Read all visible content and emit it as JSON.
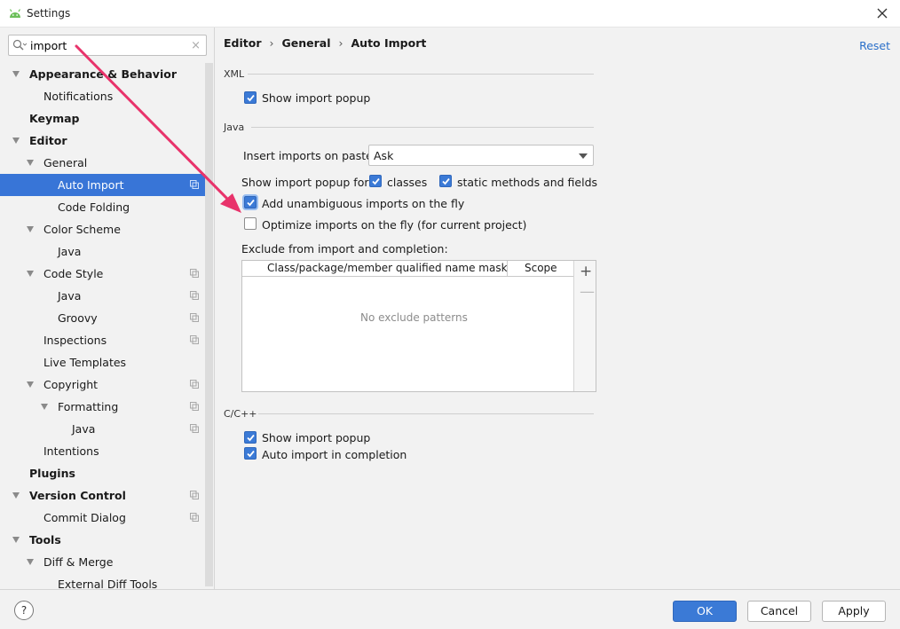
{
  "window": {
    "title": "Settings"
  },
  "search": {
    "value": "import"
  },
  "tree": [
    {
      "label": "Appearance & Behavior",
      "level": 0,
      "bold": true,
      "expanded": true,
      "copy": false
    },
    {
      "label": "Notifications",
      "level": 1,
      "bold": false,
      "expanded": null,
      "copy": false
    },
    {
      "label": "Keymap",
      "level": 0,
      "bold": true,
      "expanded": null,
      "copy": false
    },
    {
      "label": "Editor",
      "level": 0,
      "bold": true,
      "expanded": true,
      "copy": false
    },
    {
      "label": "General",
      "level": 1,
      "bold": false,
      "expanded": true,
      "copy": false
    },
    {
      "label": "Auto Import",
      "level": 2,
      "bold": false,
      "expanded": null,
      "copy": true,
      "selected": true
    },
    {
      "label": "Code Folding",
      "level": 2,
      "bold": false,
      "expanded": null,
      "copy": false
    },
    {
      "label": "Color Scheme",
      "level": 1,
      "bold": false,
      "expanded": true,
      "copy": false
    },
    {
      "label": "Java",
      "level": 2,
      "bold": false,
      "expanded": null,
      "copy": false
    },
    {
      "label": "Code Style",
      "level": 1,
      "bold": false,
      "expanded": true,
      "copy": true
    },
    {
      "label": "Java",
      "level": 2,
      "bold": false,
      "expanded": null,
      "copy": true
    },
    {
      "label": "Groovy",
      "level": 2,
      "bold": false,
      "expanded": null,
      "copy": true
    },
    {
      "label": "Inspections",
      "level": 1,
      "bold": false,
      "expanded": null,
      "copy": true
    },
    {
      "label": "Live Templates",
      "level": 1,
      "bold": false,
      "expanded": null,
      "copy": false
    },
    {
      "label": "Copyright",
      "level": 1,
      "bold": false,
      "expanded": true,
      "copy": true
    },
    {
      "label": "Formatting",
      "level": 2,
      "bold": false,
      "expanded": true,
      "copy": true
    },
    {
      "label": "Java",
      "level": 3,
      "bold": false,
      "expanded": null,
      "copy": true
    },
    {
      "label": "Intentions",
      "level": 1,
      "bold": false,
      "expanded": null,
      "copy": false
    },
    {
      "label": "Plugins",
      "level": 0,
      "bold": true,
      "expanded": null,
      "copy": false
    },
    {
      "label": "Version Control",
      "level": 0,
      "bold": true,
      "expanded": true,
      "copy": true
    },
    {
      "label": "Commit Dialog",
      "level": 1,
      "bold": false,
      "expanded": null,
      "copy": true
    },
    {
      "label": "Tools",
      "level": 0,
      "bold": true,
      "expanded": true,
      "copy": false
    },
    {
      "label": "Diff & Merge",
      "level": 1,
      "bold": false,
      "expanded": true,
      "copy": false
    },
    {
      "label": "External Diff Tools",
      "level": 2,
      "bold": false,
      "expanded": null,
      "copy": false
    }
  ],
  "breadcrumb": {
    "part1": "Editor",
    "sep": "›",
    "part2": "General",
    "part3": "Auto Import"
  },
  "reset_label": "Reset",
  "xml": {
    "title": "XML",
    "show_popup": {
      "label": "Show import popup",
      "checked": true
    }
  },
  "java": {
    "title": "Java",
    "insert_label": "Insert imports on paste:",
    "insert_value": "Ask",
    "popup_for_label": "Show import popup for:",
    "classes": {
      "label": "classes",
      "checked": true
    },
    "static_methods": {
      "label": "static methods and fields",
      "checked": true
    },
    "add_unambiguous": {
      "label": "Add unambiguous imports on the fly",
      "checked": true
    },
    "optimize": {
      "label": "Optimize imports on the fly (for current project)",
      "checked": false
    },
    "exclude_label": "Exclude from import and completion:",
    "table": {
      "col1": "Class/package/member qualified name mask",
      "col2": "Scope",
      "empty": "No exclude patterns",
      "add": "+",
      "remove": "—"
    }
  },
  "cpp": {
    "title": "C/C++",
    "show_popup": {
      "label": "Show import popup",
      "checked": true
    },
    "auto_import": {
      "label": "Auto import in completion",
      "checked": true
    }
  },
  "footer": {
    "help": "?",
    "ok": "OK",
    "cancel": "Cancel",
    "apply": "Apply"
  },
  "colors": {
    "accent": "#3b7ad6",
    "selection": "#3875d7",
    "annotation_arrow": "#e8336b"
  }
}
